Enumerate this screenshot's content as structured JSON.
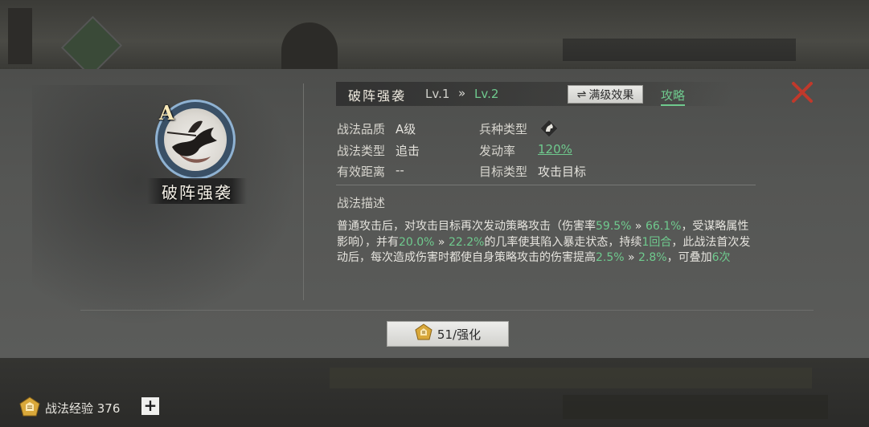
{
  "skill": {
    "name": "破阵强袭",
    "grade_badge": "A",
    "level_current": "Lv.1",
    "level_arrow": "»",
    "level_next": "Lv.2"
  },
  "header": {
    "max_level_button": "满级效果",
    "max_level_icon": "swap-arrows-icon",
    "guide_link": "攻略",
    "close_icon": "close-x-icon"
  },
  "attributes": {
    "quality_label": "战法品质",
    "quality_value": "A级",
    "troop_type_label": "兵种类型",
    "troop_type_icon": "cavalry-horse-icon",
    "skill_type_label": "战法类型",
    "skill_type_value": "追击",
    "trigger_rate_label": "发动率",
    "trigger_rate_value": "120%",
    "range_label": "有效距离",
    "range_value": "--",
    "target_label": "目标类型",
    "target_value": "攻击目标"
  },
  "description": {
    "title": "战法描述",
    "segments": [
      "普通攻击后，对攻击目标再次发动策略攻击（伤害率",
      "59.5%",
      " » ",
      "66.1%",
      "，受谋略属性影响），并有",
      "20.0%",
      " » ",
      "22.2%",
      "的几率使其陷入暴走状态，持续",
      "1回合",
      "，此战法首次发动后，每次造成伤害时都使自身策略攻击的伤害提高",
      "2.5%",
      " » ",
      "2.8%",
      "，可叠加",
      "6次"
    ]
  },
  "enhance": {
    "label": "51/强化",
    "icon": "skill-book-icon"
  },
  "bottom_bar": {
    "exp_label": "战法经验 376",
    "exp_icon": "skill-book-icon",
    "plus_label": "+"
  },
  "colors": {
    "accent_green": "#6fca8e",
    "close_red": "#c0392b"
  }
}
